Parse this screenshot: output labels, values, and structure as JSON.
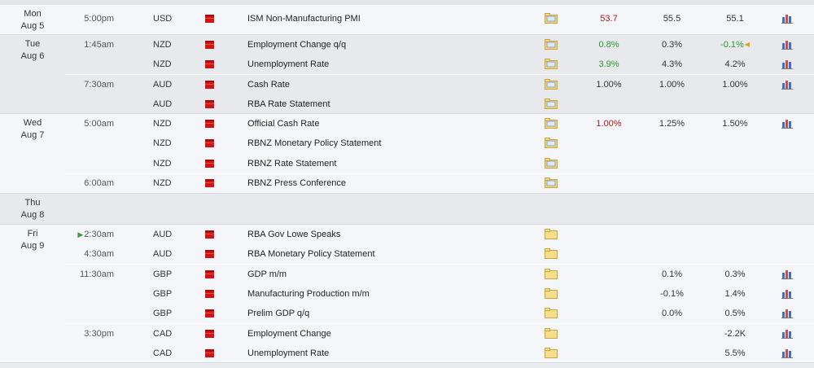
{
  "days": [
    {
      "label_day": "Mon",
      "label_date": "Aug 5"
    },
    {
      "label_day": "Tue",
      "label_date": "Aug 6"
    },
    {
      "label_day": "Wed",
      "label_date": "Aug 7"
    },
    {
      "label_day": "Thu",
      "label_date": "Aug 8"
    },
    {
      "label_day": "Fri",
      "label_date": "Aug 9"
    }
  ],
  "events": [
    {
      "time": "5:00pm",
      "currency": "USD",
      "name": "ISM Non-Manufacturing PMI",
      "actual": "53.7",
      "forecast": "55.5",
      "previous": "55.1"
    },
    {
      "time": "1:45am",
      "currency": "NZD",
      "name": "Employment Change q/q",
      "actual": "0.8%",
      "forecast": "0.3%",
      "previous": "-0.1%"
    },
    {
      "time": "",
      "currency": "NZD",
      "name": "Unemployment Rate",
      "actual": "3.9%",
      "forecast": "4.3%",
      "previous": "4.2%"
    },
    {
      "time": "7:30am",
      "currency": "AUD",
      "name": "Cash Rate",
      "actual": "1.00%",
      "forecast": "1.00%",
      "previous": "1.00%"
    },
    {
      "time": "",
      "currency": "AUD",
      "name": "RBA Rate Statement",
      "actual": "",
      "forecast": "",
      "previous": ""
    },
    {
      "time": "5:00am",
      "currency": "NZD",
      "name": "Official Cash Rate",
      "actual": "1.00%",
      "forecast": "1.25%",
      "previous": "1.50%"
    },
    {
      "time": "",
      "currency": "NZD",
      "name": "RBNZ Monetary Policy Statement",
      "actual": "",
      "forecast": "",
      "previous": ""
    },
    {
      "time": "",
      "currency": "NZD",
      "name": "RBNZ Rate Statement",
      "actual": "",
      "forecast": "",
      "previous": ""
    },
    {
      "time": "6:00am",
      "currency": "NZD",
      "name": "RBNZ Press Conference",
      "actual": "",
      "forecast": "",
      "previous": ""
    },
    {
      "time": "2:30am",
      "currency": "AUD",
      "name": "RBA Gov Lowe Speaks",
      "actual": "",
      "forecast": "",
      "previous": ""
    },
    {
      "time": "4:30am",
      "currency": "AUD",
      "name": "RBA Monetary Policy Statement",
      "actual": "",
      "forecast": "",
      "previous": ""
    },
    {
      "time": "11:30am",
      "currency": "GBP",
      "name": "GDP m/m",
      "actual": "",
      "forecast": "0.1%",
      "previous": "0.3%"
    },
    {
      "time": "",
      "currency": "GBP",
      "name": "Manufacturing Production m/m",
      "actual": "",
      "forecast": "-0.1%",
      "previous": "1.4%"
    },
    {
      "time": "",
      "currency": "GBP",
      "name": "Prelim GDP q/q",
      "actual": "",
      "forecast": "0.0%",
      "previous": "0.5%"
    },
    {
      "time": "3:30pm",
      "currency": "CAD",
      "name": "Employment Change",
      "actual": "",
      "forecast": "",
      "previous": "-2.2K"
    },
    {
      "time": "",
      "currency": "CAD",
      "name": "Unemployment Rate",
      "actual": "",
      "forecast": "",
      "previous": "5.5%"
    }
  ],
  "colors": {
    "better": "#2c9a2c",
    "worse": "#b01c1c",
    "flag": "#d01414"
  }
}
